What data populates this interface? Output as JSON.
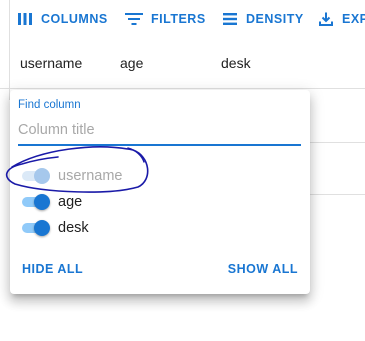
{
  "toolbar": {
    "columns_label": "COLUMNS",
    "columns_icon": "view-column-icon",
    "filters_label": "FILTERS",
    "filters_icon": "filter-list-icon",
    "density_label": "DENSITY",
    "density_icon": "density-icon",
    "export_label": "EXP",
    "export_icon": "export-icon"
  },
  "grid": {
    "headers": [
      "username",
      "age",
      "desk"
    ]
  },
  "columns_panel": {
    "find_label": "Find column",
    "find_placeholder": "Column title",
    "find_value": "",
    "columns": [
      {
        "label": "username",
        "checked": true,
        "disabled": true
      },
      {
        "label": "age",
        "checked": true,
        "disabled": false
      },
      {
        "label": "desk",
        "checked": true,
        "disabled": false
      }
    ],
    "hide_all_label": "HIDE ALL",
    "show_all_label": "SHOW ALL"
  },
  "colors": {
    "accent": "#1976d2",
    "switch_track": "#90caf9",
    "annotation_ink": "#1a1aa8"
  }
}
